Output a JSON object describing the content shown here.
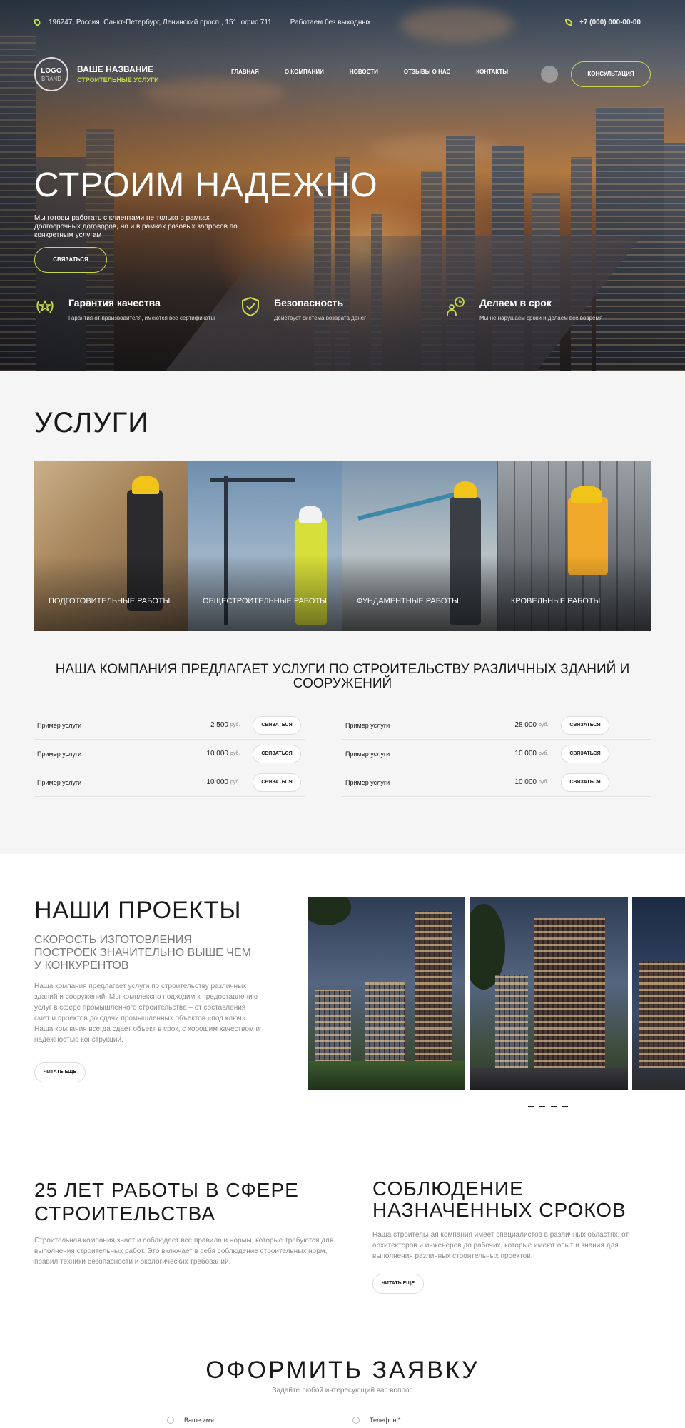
{
  "topbar": {
    "address": "196247, Россия, Санкт-Петербург, Ленинский просп., 151, офис 711",
    "hours": "Работаем без выходных",
    "phone": "+7 (000) 000-00-00"
  },
  "brand": {
    "logo_line1": "LOGO",
    "logo_line2": "BRAND",
    "name": "ВАШЕ НАЗВАНИЕ",
    "subtitle": "СТРОИТЕЛЬНЫЕ УСЛУГИ"
  },
  "nav": [
    {
      "label": "ГЛАВНАЯ"
    },
    {
      "label": "О КОМПАНИИ"
    },
    {
      "label": "НОВОСТИ"
    },
    {
      "label": "ОТЗЫВЫ О НАС"
    },
    {
      "label": "КОНТАКТЫ"
    }
  ],
  "header": {
    "more_label": "...",
    "consult_button": "КОНСУЛЬТАЦИЯ"
  },
  "hero": {
    "title": "СТРОИМ НАДЕЖНО",
    "lead": "Мы готовы работать с клиентами не только в рамках долгосрочных договоров, но и в рамках разовых запросов по конкретным услугам",
    "cta": "СВЯЗАТЬСЯ",
    "features": [
      {
        "title": "Гарантия качества",
        "desc": "Гарантия от производителя, имеются все сертификаты",
        "icon": "wreath-star-icon"
      },
      {
        "title": "Безопасность",
        "desc": "Действует система возврата денег",
        "icon": "shield-check-icon"
      },
      {
        "title": "Делаем в срок",
        "desc": "Мы не нарушаем сроки и делаем все вовремя",
        "icon": "person-clock-icon"
      }
    ]
  },
  "services": {
    "title": "УСЛУГИ",
    "cards": [
      {
        "label": "ПОДГОТОВИТЕЛЬНЫЕ РАБОТЫ"
      },
      {
        "label": "ОБЩЕСТРОИТЕЛЬНЫЕ РАБОТЫ"
      },
      {
        "label": "ФУНДАМЕНТНЫЕ РАБОТЫ"
      },
      {
        "label": "КРОВЕЛЬНЫЕ РАБОТЫ"
      }
    ],
    "offer": "НАША КОМПАНИЯ ПРЕДЛАГАЕТ УСЛУГИ ПО СТРОИТЕЛЬСТВУ РАЗЛИЧНЫХ ЗДАНИЙ И СООРУЖЕНИЙ",
    "currency": "руб.",
    "button": "СВЯЗАТЬСЯ",
    "prices": [
      {
        "name": "Пример услуги",
        "price": "2 500"
      },
      {
        "name": "Пример услуги",
        "price": "28 000"
      },
      {
        "name": "Пример услуги",
        "price": "10 000"
      },
      {
        "name": "Пример услуги",
        "price": "10 000"
      },
      {
        "name": "Пример услуги",
        "price": "10 000"
      },
      {
        "name": "Пример услуги",
        "price": "10 000"
      }
    ]
  },
  "projects": {
    "title": "НАШИ ПРОЕКТЫ",
    "subtitle": "СКОРОСТЬ ИЗГОТОВЛЕНИЯ ПОСТРОЕК ЗНАЧИТЕЛЬНО ВЫШЕ ЧЕМ У КОНКУРЕНТОВ",
    "text": "Наша компания предлагает услуги по строительству различных зданий и сооружений. Мы комплексно подходим к предоставлению услуг в сфере промышленного строительства – от составления смет и проектов до сдачи промышленных объектов «под ключ». Наша компания всегда сдает объект в срок, с хорошим качеством и надежностью конструкций.",
    "button": "ЧИТАТЬ ЕЩЕ",
    "pager": [
      "-",
      "-",
      "-",
      "-"
    ]
  },
  "about": [
    {
      "title": "25 ЛЕТ РАБОТЫ В СФЕРЕ СТРОИТЕЛЬСТВА",
      "text": "Строительная компания знает и соблюдает все правила и нормы, которые требуются для выполнения строительных работ. Это включает в себя соблюдение строительных норм, правил техники безопасности и экологических требований."
    },
    {
      "title": "СОБЛЮДЕНИЕ НАЗНАЧЕННЫХ СРОКОВ",
      "text": "Наша строительная компания имеет специалистов в различных областях, от архитекторов и инженеров до рабочих, которые имеют опыт и знания для выполнения различных строительных проектов.",
      "button": "ЧИТАТЬ ЕЩЕ"
    }
  ],
  "form": {
    "title": "ОФОРМИТЬ ЗАЯВКУ",
    "subtitle": "Задайте любой интересующий вас вопрос",
    "name_label": "Ваше имя",
    "phone_label": "Телефон *"
  },
  "colors": {
    "accent": "#c7d94a",
    "dark": "#1a1a1a",
    "muted": "#8a8a8a",
    "section_bg": "#f5f5f5"
  }
}
